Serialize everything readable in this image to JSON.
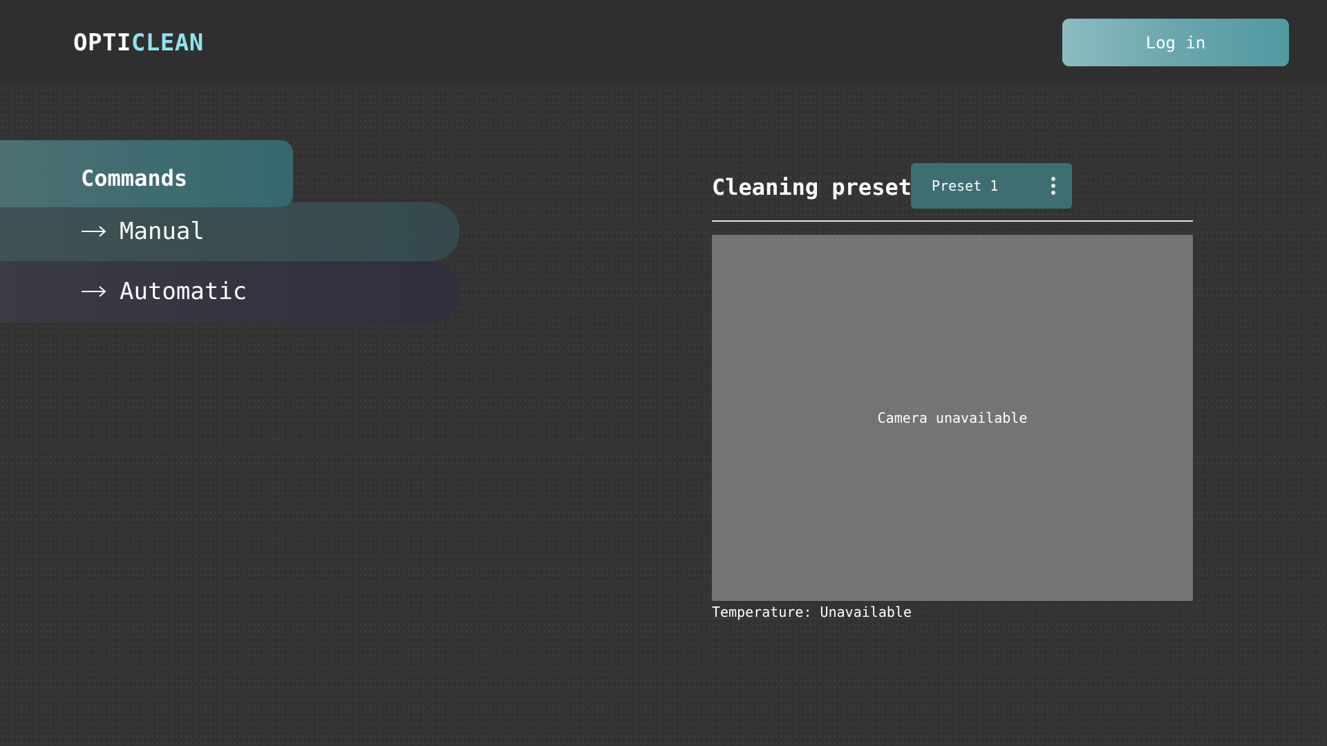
{
  "header": {
    "logo_part1": "OPTI",
    "logo_part2": "CLEAN",
    "login_label": "Log in"
  },
  "menu": {
    "commands_label": "Commands",
    "items": [
      {
        "label": "Manual",
        "icon": "arrow-right-icon"
      },
      {
        "label": "Automatic",
        "icon": "arrow-right-icon"
      }
    ]
  },
  "preset": {
    "title": "Cleaning preset",
    "selected": "Preset 1",
    "menu_icon": "kebab-icon"
  },
  "camera": {
    "status": "Camera unavailable"
  },
  "temperature": {
    "text": "Temperature: Unavailable"
  },
  "colors": {
    "accent_logo": "#8fe3ea",
    "login_gradient_start": "#8cbcc0",
    "login_gradient_end": "#5099a1",
    "commands_bg": "#3f6c71",
    "preset_select_bg": "#3f6e72",
    "camera_bg": "#747474"
  }
}
